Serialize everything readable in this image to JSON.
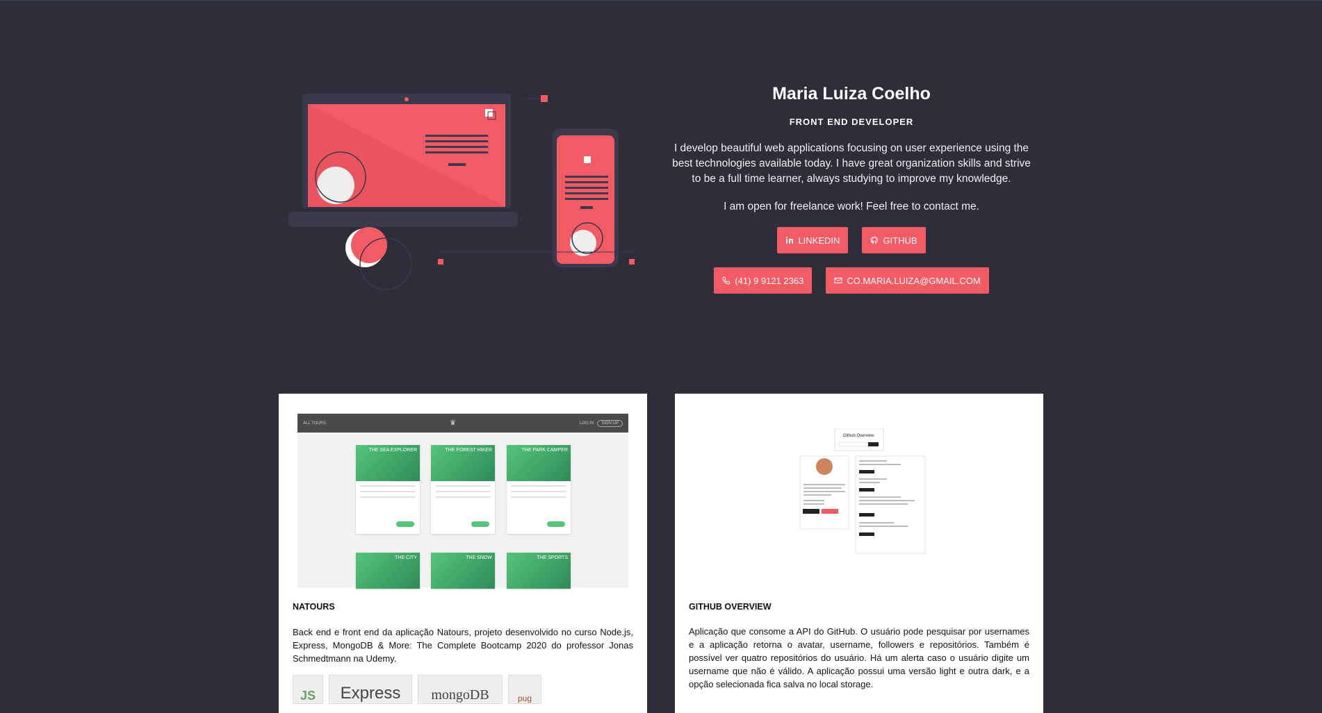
{
  "profile": {
    "name": "Maria Luiza Coelho",
    "role": "FRONT END DEVELOPER",
    "bio": "I develop beautiful web applications focusing on user experience using the best technologies available today. I have great organization skills and strive to be a full time learner, always studying to improve my knowledge.",
    "freelance": "I am open for freelance work! Feel free to contact me."
  },
  "buttons": {
    "linkedin": "LINKEDIN",
    "github": "GITHUB",
    "phone": "(41) 9 9121 2363",
    "email": "CO.MARIA.LUIZA@GMAIL.COM"
  },
  "icons": {
    "linkedin": "linkedin-icon",
    "github": "github-icon",
    "phone": "phone-icon",
    "email": "mail-icon"
  },
  "projects": [
    {
      "title": "NATOURS",
      "description": "Back end e front end da aplicação Natours, projeto desenvolvido no curso Node.js, Express, MongoDB & More: The Complete Bootcamp 2020 do professor Jonas Schmedtmann na Udemy.",
      "screenshot": {
        "brand": "ALL TOURS",
        "login": "LOG IN",
        "signup": "SIGN UP",
        "tours": [
          "THE SEA EXPLORER",
          "THE FOREST HIKER",
          "THE PARK CAMPER",
          "THE CITY",
          "THE SNOW",
          "THE SPORTS"
        ]
      },
      "tech": [
        "JS",
        "Express",
        "mongoDB",
        "pug"
      ]
    },
    {
      "title": "GITHUB OVERVIEW",
      "description": "Aplicação que consome a API do GitHub. O usuário pode pesquisar por usernames e a aplicação retorna o avatar, username, followers e repositórios. Também é possível ver quatro repositórios do usuário. Há um alerta caso o usuário digite um username que não é válido. A aplicação possui uma versão light e outra dark, e a opção selecionada fica salva no local storage.",
      "screenshot": {
        "title": "Github Overview"
      }
    }
  ],
  "colors": {
    "background": "#2d2e3a",
    "accent": "#f25a64",
    "card": "#ffffff"
  }
}
